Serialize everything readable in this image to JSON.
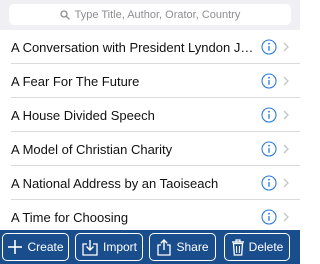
{
  "search": {
    "placeholder": "Type Title, Author, Orator, Country"
  },
  "list": {
    "items": [
      {
        "title": "A Conversation with President Lyndon John..."
      },
      {
        "title": "A Fear For The Future"
      },
      {
        "title": "A House Divided Speech"
      },
      {
        "title": "A Model of Christian Charity"
      },
      {
        "title": "A National Address by an Taoiseach"
      },
      {
        "title": "A Time for Choosing"
      }
    ]
  },
  "toolbar": {
    "create_label": "Create",
    "import_label": "Import",
    "share_label": "Share",
    "delete_label": "Delete"
  },
  "colors": {
    "toolbar_bg": "#1a4d8c",
    "accent": "#2f7bd8",
    "search_bg": "#efeff4",
    "separator": "#d9d9de"
  },
  "icons": {
    "search": "search-icon",
    "info": "info-icon",
    "chevron": "chevron-right-icon",
    "create": "plus-icon",
    "import": "import-tray-icon",
    "share": "share-icon",
    "delete": "trash-icon"
  }
}
